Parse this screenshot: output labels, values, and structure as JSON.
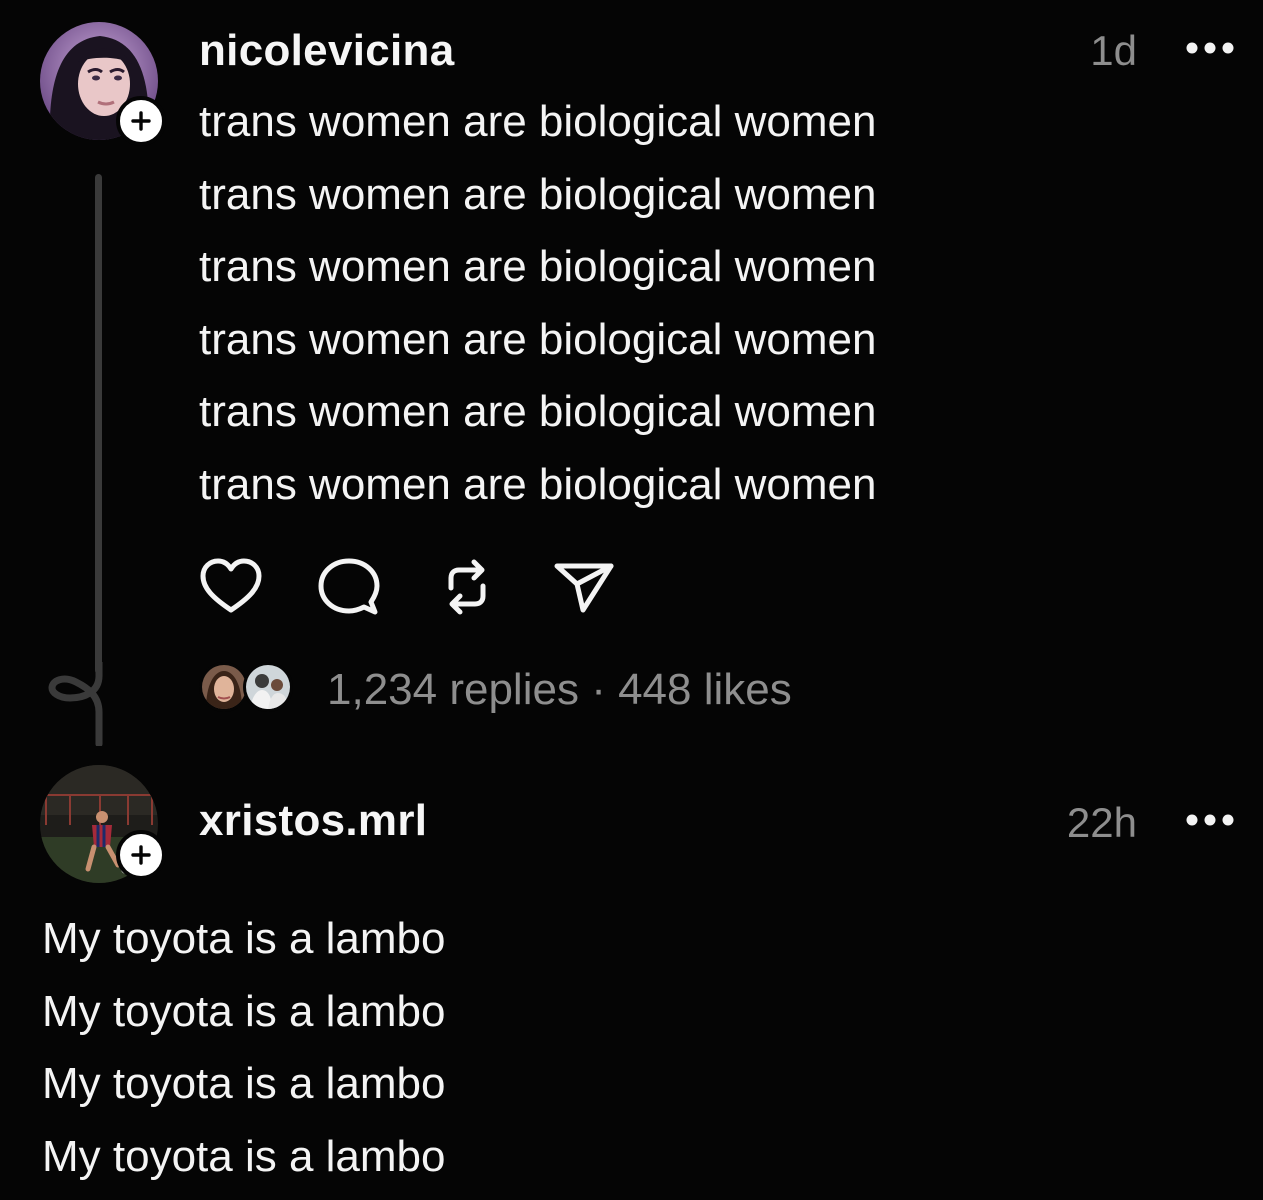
{
  "posts": [
    {
      "username": "nicolevicina",
      "timestamp": "1d",
      "lines": [
        "trans women are biological women",
        "trans women are biological women",
        "trans women are biological women",
        "trans women are biological women",
        "trans women are biological women",
        "trans women are biological women"
      ],
      "replies": "1,234 replies",
      "separator": "·",
      "likes": "448 likes",
      "icons": [
        "heart-icon",
        "comment-icon",
        "repost-icon",
        "share-icon"
      ]
    },
    {
      "username": "xristos.mrl",
      "timestamp": "22h",
      "lines": [
        "My toyota is a lambo",
        "My toyota is a lambo",
        "My toyota is a lambo",
        "My toyota is a lambo"
      ]
    }
  ],
  "colors": {
    "background": "#050505",
    "text": "#f4f4f4",
    "muted": "#8e8e8e",
    "thread_line": "#3a3a3a"
  }
}
